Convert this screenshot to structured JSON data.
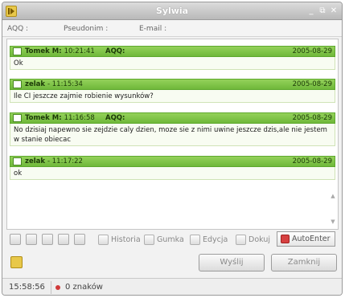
{
  "window": {
    "title": "Sylwia"
  },
  "info": {
    "aqq_label": "AQQ :",
    "nick_label": "Pseudonim :",
    "email_label": "E-mail :"
  },
  "messages": [
    {
      "sender": "Tomek M:",
      "time": "10:21:41",
      "tag": "AQQ:",
      "date": "2005-08-29",
      "text": "Ok"
    },
    {
      "sender": "zelak",
      "time": "- 11:15:34",
      "tag": "",
      "date": "2005-08-29",
      "text": "Ile CI jeszcze zajmie robienie wysunków?"
    },
    {
      "sender": "Tomek M:",
      "time": "11:16:58",
      "tag": "AQQ:",
      "date": "2005-08-29",
      "text": "No dzisiaj napewno sie zejdzie caly dzien, moze sie z nimi uwine jeszcze dzis,ale nie jestem w stanie obiecac"
    },
    {
      "sender": "zelak",
      "time": "- 11:17:22",
      "tag": "",
      "date": "2005-08-29",
      "text": "ok"
    }
  ],
  "toolbar": {
    "historia": "Historia",
    "gumka": "Gumka",
    "edycja": "Edycja",
    "dokuj": "Dokuj",
    "autoenter": "AutoEnter"
  },
  "buttons": {
    "send": "Wyślij",
    "close": "Zamknij"
  },
  "status": {
    "time": "15:58:56",
    "chars": "0 znaków"
  },
  "colors": {
    "header_green": "#7cc244",
    "body_tint": "#f8fcf2",
    "status_red": "#d03a3a"
  }
}
